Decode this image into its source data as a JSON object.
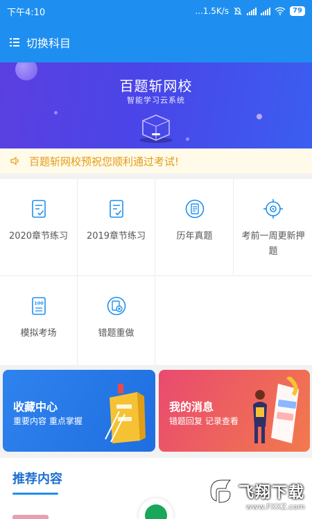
{
  "status_bar": {
    "time": "下午4:10",
    "net_speed": "...1.5K/s",
    "battery": "79"
  },
  "app_bar": {
    "title": "切换科目",
    "icon": "menu-list-icon"
  },
  "banner": {
    "title": "百题斩网校",
    "subtitle": "智能学习云系统"
  },
  "notice": {
    "icon": "speaker-icon",
    "text": "百题斩网校预祝您顺利通过考试!"
  },
  "menu": [
    {
      "label": "2020章节练习",
      "icon": "exercise-doc-icon"
    },
    {
      "label": "2019章节练习",
      "icon": "exercise-doc-icon"
    },
    {
      "label": "历年真题",
      "icon": "past-papers-icon"
    },
    {
      "label": "考前一周更新押题",
      "icon": "target-icon"
    },
    {
      "label": "模拟考场",
      "icon": "mock-exam-icon"
    },
    {
      "label": "错题重做",
      "icon": "mistake-redo-icon"
    }
  ],
  "cards": {
    "favorites": {
      "title": "收藏中心",
      "subtitle": "重要内容 重点掌握",
      "color": "#2a7de8"
    },
    "messages": {
      "title": "我的消息",
      "subtitle": "错题回复 记录查看",
      "color": "#e8506a"
    }
  },
  "recommend": {
    "title": "推荐内容"
  },
  "watermark": {
    "text": "飞翔下载",
    "url": "www.FXXZ.com"
  },
  "colors": {
    "primary": "#1e8ff0",
    "notice_text": "#e59a1a",
    "notice_bg": "#fffbe8"
  }
}
